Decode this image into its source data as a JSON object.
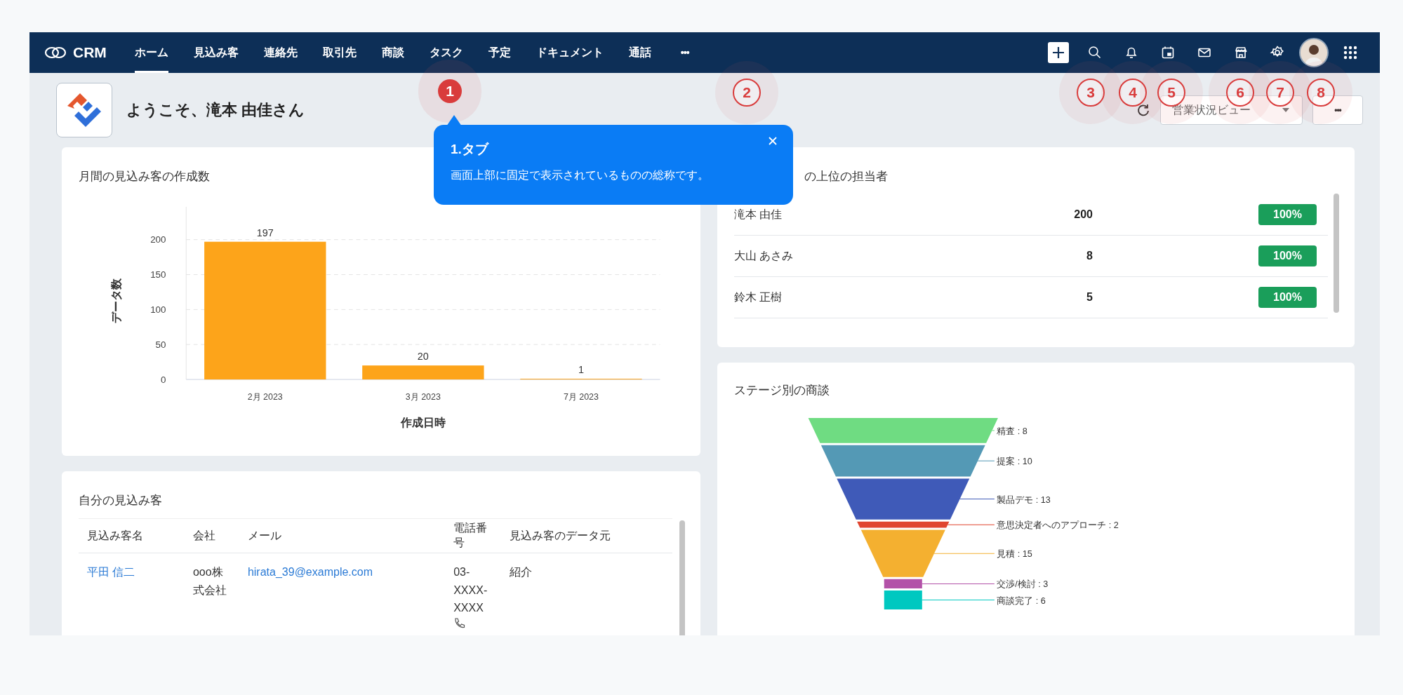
{
  "nav": {
    "brand": "CRM",
    "tabs": [
      {
        "label": "ホーム",
        "selected": true
      },
      {
        "label": "見込み客",
        "selected": false
      },
      {
        "label": "連絡先",
        "selected": false
      },
      {
        "label": "取引先",
        "selected": false
      },
      {
        "label": "商談",
        "selected": false
      },
      {
        "label": "タスク",
        "selected": false
      },
      {
        "label": "予定",
        "selected": false
      },
      {
        "label": "ドキュメント",
        "selected": false
      },
      {
        "label": "通話",
        "selected": false
      }
    ],
    "more": "•••"
  },
  "header": {
    "greeting": "ようこそ、滝本 由佳さん",
    "view_select": "営業状況ビュー",
    "more": "•••"
  },
  "lead_chart_card": {
    "title": "月間の見込み客の作成数",
    "chart_data": {
      "type": "bar",
      "xlabel": "作成日時",
      "ylabel": "データ数",
      "categories": [
        "2月 2023",
        "3月 2023",
        "7月 2023"
      ],
      "values": [
        197,
        20,
        1
      ],
      "ylim": [
        0,
        245
      ],
      "yticks": [
        0,
        50,
        100,
        150,
        200
      ],
      "grid": true,
      "data_labels": true
    }
  },
  "top_reps_card": {
    "title": "の上位の担当者",
    "rows": [
      {
        "name": "滝本 由佳",
        "count": "200",
        "change": "100%"
      },
      {
        "name": "大山 あさみ",
        "count": "8",
        "change": "100%"
      },
      {
        "name": "鈴木 正樹",
        "count": "5",
        "change": "100%"
      }
    ]
  },
  "my_leads_card": {
    "title": "自分の見込み客",
    "columns": [
      "見込み客名",
      "会社",
      "メール",
      "電話番号",
      "見込み客のデータ元"
    ],
    "rows": [
      {
        "name": "平田 信二",
        "company": "ooo株式会社",
        "email": "hirata_39@example.com",
        "phone": "03-XXXX-XXXX",
        "source": "紹介"
      }
    ]
  },
  "stage_card": {
    "title": "ステージ別の商談",
    "stages": [
      {
        "label": "精査 : 8",
        "color": "#6fdc82"
      },
      {
        "label": "提案 : 10",
        "color": "#5499b5"
      },
      {
        "label": "製品デモ : 13",
        "color": "#3f5ab8"
      },
      {
        "label": "意思決定者へのアプローチ : 2",
        "color": "#e0452f"
      },
      {
        "label": "見積 : 15",
        "color": "#f4b030"
      },
      {
        "label": "交渉/検討 : 3",
        "color": "#b351a8"
      },
      {
        "label": "商談完了 : 6",
        "color": "#00c8c0"
      }
    ]
  },
  "tooltip": {
    "title": "1.タブ",
    "body": "画面上部に固定で表示されているものの総称です。"
  },
  "markers": [
    {
      "number": "1",
      "kind": "filled"
    },
    {
      "number": "2",
      "kind": "outline"
    },
    {
      "number": "3",
      "kind": "outline"
    },
    {
      "number": "4",
      "kind": "outline"
    },
    {
      "number": "5",
      "kind": "outline"
    },
    {
      "number": "6",
      "kind": "outline"
    },
    {
      "number": "7",
      "kind": "outline"
    },
    {
      "number": "8",
      "kind": "outline"
    }
  ]
}
